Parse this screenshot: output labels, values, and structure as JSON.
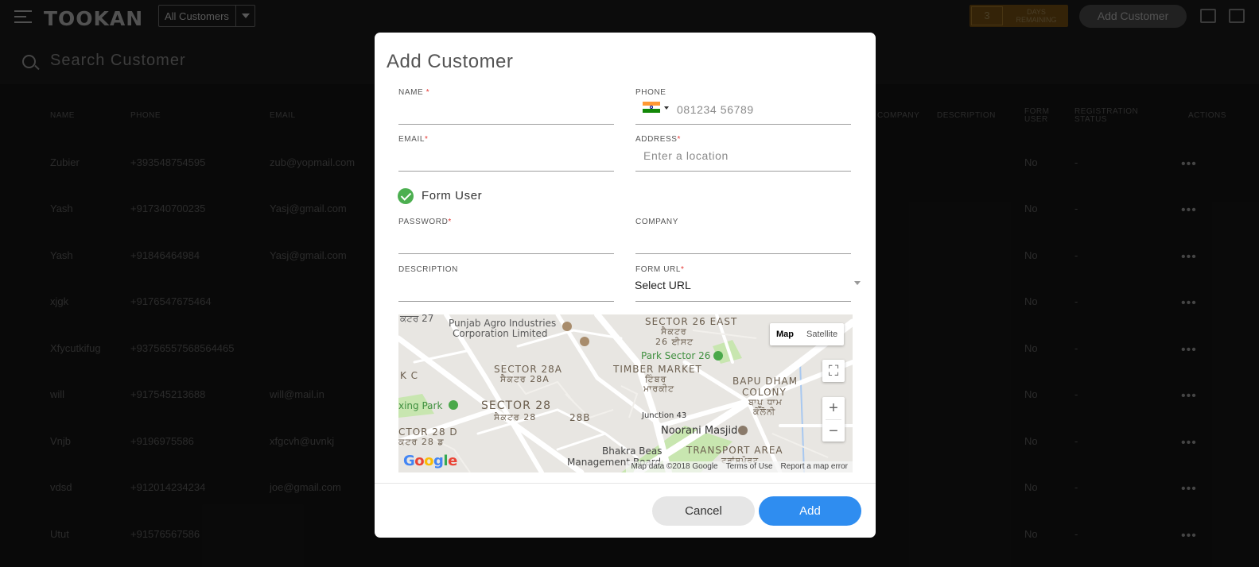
{
  "app": {
    "logo": "TOOKAN",
    "filter_selected": "All Customers",
    "days_count": "3",
    "days_label": "DAYS REMAINING",
    "add_customer_label": "Add Customer",
    "search_placeholder": "Search Customer"
  },
  "table": {
    "headers": [
      "NAME",
      "PHONE",
      "EMAIL",
      "COMPANY",
      "DESCRIPTION",
      "FORM USER",
      "REGISTRATION STATUS",
      "ACTIONS"
    ],
    "rows": [
      {
        "name": "Zubier",
        "phone": "+393548754595",
        "email": "zub@yopmail.com",
        "form_user": "No",
        "status": "-"
      },
      {
        "name": "Yash",
        "phone": "+917340700235",
        "email": "Yasj@gmail.com",
        "form_user": "No",
        "status": "-"
      },
      {
        "name": "Yash",
        "phone": "+91846464984",
        "email": "Yasj@gmail.com",
        "form_user": "No",
        "status": "-"
      },
      {
        "name": "xjgk",
        "phone": "+9176547675464",
        "email": "",
        "form_user": "No",
        "status": "-"
      },
      {
        "name": "Xfycutkifug",
        "phone": "+93756557568564465",
        "email": "",
        "form_user": "No",
        "status": "-"
      },
      {
        "name": "will",
        "phone": "+917545213688",
        "email": "will@mail.in",
        "form_user": "No",
        "status": "-"
      },
      {
        "name": "Vnjb",
        "phone": "+9196975586",
        "email": "xfgcvh@uvnkj",
        "form_user": "No",
        "status": "-"
      },
      {
        "name": "vdsd",
        "phone": "+912014234234",
        "email": "joe@gmail.com",
        "form_user": "No",
        "status": "-"
      },
      {
        "name": "Utut",
        "phone": "+91576567586",
        "email": "",
        "form_user": "No",
        "status": "-"
      }
    ]
  },
  "modal": {
    "title": "Add Customer",
    "name_label": "NAME",
    "phone_label": "PHONE",
    "phone_placeholder": "081234 56789",
    "email_label": "EMAIL",
    "address_label": "ADDRESS",
    "address_placeholder": "Enter a location",
    "form_user_label": "Form User",
    "password_label": "PASSWORD",
    "company_label": "COMPANY",
    "description_label": "DESCRIPTION",
    "form_url_label": "FORM URL",
    "form_url_value": "Select URL",
    "required_mark": "*",
    "cancel_label": "Cancel",
    "add_label": "Add"
  },
  "map": {
    "map_btn": "Map",
    "satellite_btn": "Satellite",
    "labels": {
      "punjab_agro": "Punjab Agro Industries",
      "corporation": "Corporation Limited",
      "sector26east": "SECTOR 26 EAST",
      "sector26_gurmukhi1": "ਸੈਕਟਰ",
      "sector26_gurmukhi2": "26 ਈਸਟ",
      "park_sector": "Park Sector 26",
      "sector28a": "SECTOR 28A",
      "sector28a_g": "ਸੈਕਟਰ 28A",
      "timber_market": "TIMBER MARKET",
      "timber_g1": "ਟਿੰਬਰ",
      "timber_g2": "ਮਾਰਕੀਟ",
      "bapu_dham": "BAPU DHAM",
      "colony": "COLONY",
      "bapu_g1": "ਬਾਪੂ ਧਾਮ",
      "bapu_g2": "ਕੋਲੋਨੀ",
      "sector28": "SECTOR 28",
      "sector28_g": "ਸੈਕਟਰ 28",
      "n28b": "28B",
      "junction": "Junction 43",
      "noorani": "Noorani Masjid",
      "boxing_park": "xing Park",
      "sector28d": "CTOR 28 D",
      "sector28d_g": "ਕਟਰ 28 ਡ",
      "kc": "K C",
      "r27": "ਕਟਰ 27",
      "bhakra": "Bhakra Beas",
      "management": "Management Board",
      "transport": "TRANSPORT AREA",
      "transport_g": "ਟਰਾਂਸਪੋਰਟ"
    },
    "google": "Google",
    "attribution": "Map data ©2018 Google",
    "terms": "Terms of Use",
    "report": "Report a map error"
  },
  "colors": {
    "primary": "#2f8df0",
    "success": "#4caf50",
    "required": "#e53935"
  }
}
